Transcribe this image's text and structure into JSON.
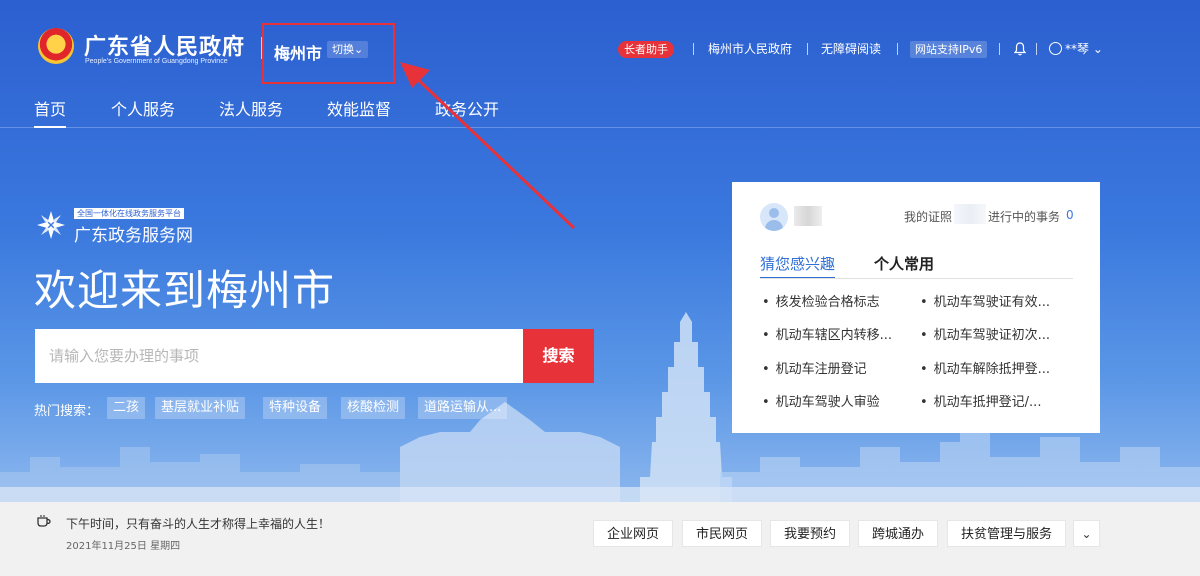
{
  "header": {
    "title": "广东省人民政府",
    "subtitle": "People's Government of Guangdong Province",
    "city": "梅州市",
    "switch_label": "切换",
    "elder_mode": "长者助手",
    "links": [
      "梅州市人民政府",
      "无障碍阅读"
    ],
    "ipv6": "网站支持IPv6",
    "user": "**琴"
  },
  "nav": {
    "items": [
      "首页",
      "个人服务",
      "法人服务",
      "效能监督",
      "政务公开"
    ]
  },
  "brand": {
    "tagline": "全国一体化在线政务服务平台",
    "name": "广东政务服务网"
  },
  "welcome": "欢迎来到梅州市",
  "search": {
    "placeholder": "请输入您要办理的事项",
    "button": "搜索",
    "hot_label": "热门搜索：",
    "hot_items": [
      "二孩",
      "基层就业补贴",
      "特种设备",
      "核酸检测",
      "道路运输从..."
    ]
  },
  "card": {
    "my_cert": "我的证照",
    "in_progress": "进行中的事务",
    "count": "0",
    "tabs": [
      "猜您感兴趣",
      "个人常用"
    ],
    "items": [
      "核发检验合格标志",
      "机动车驾驶证有效...",
      "机动车辖区内转移...",
      "机动车驾驶证初次...",
      "机动车注册登记",
      "机动车解除抵押登...",
      "机动车驾驶人审验",
      "机动车抵押登记/..."
    ]
  },
  "bottom": {
    "tip": "下午时间，只有奋斗的人生才称得上幸福的人生！",
    "date": "2021年11月25日 星期四",
    "quick_links": [
      "企业网页",
      "市民网页",
      "我要预约",
      "跨城通办",
      "扶贫管理与服务"
    ]
  },
  "colors": {
    "primary": "#2f6fd6",
    "accent_red": "#e8323a"
  }
}
